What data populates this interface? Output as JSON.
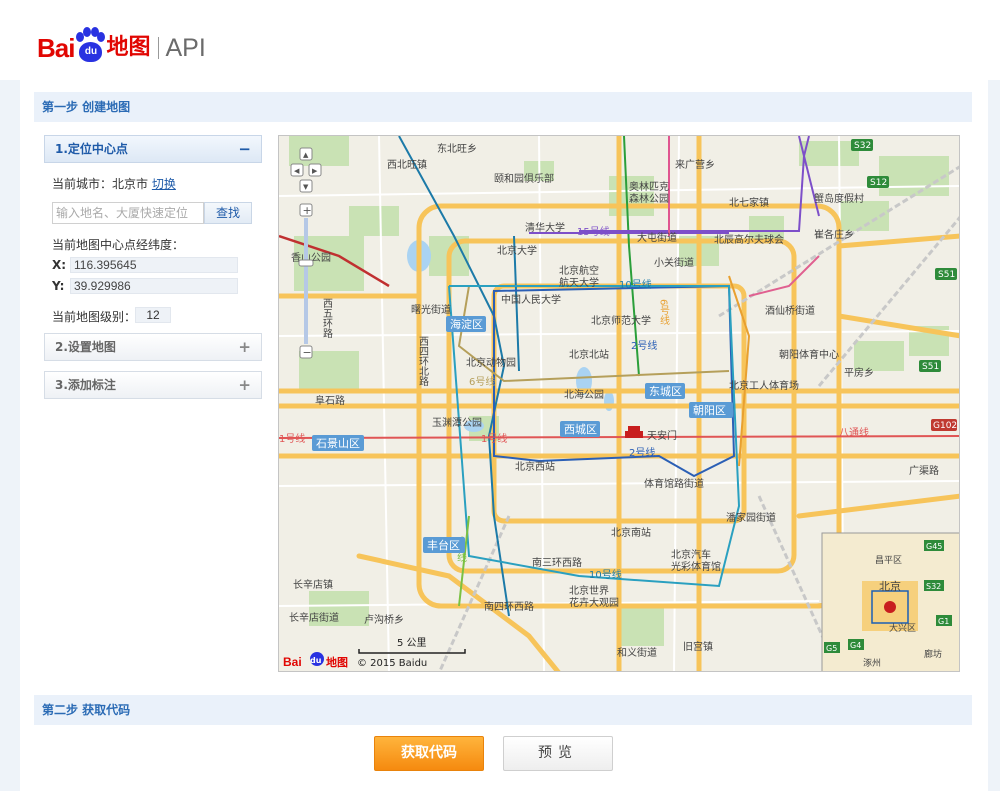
{
  "header": {
    "logo_bai": "Bai",
    "logo_du": "du",
    "logo_map": "地图",
    "logo_api": "API"
  },
  "step1": {
    "title": "第一步 创建地图"
  },
  "sections": [
    {
      "label": "1.定位中心点",
      "sign": "−",
      "expanded": true
    },
    {
      "label": "2.设置地图",
      "sign": "+",
      "expanded": false
    },
    {
      "label": "3.添加标注",
      "sign": "+",
      "expanded": false
    }
  ],
  "locate": {
    "city_label": "当前城市：",
    "city_value": "北京市",
    "switch_link": "切换",
    "search_placeholder": "输入地名、大厦快速定位",
    "search_button": "查找",
    "center_label": "当前地图中心点经纬度：",
    "x_label": "X:",
    "x_value": "116.395645",
    "y_label": "Y:",
    "y_value": "39.929986",
    "zoom_label": "当前地图级别：",
    "zoom_value": "12"
  },
  "map": {
    "scale_label": "5 公里",
    "copyright": "© 2015 Baidu",
    "logo_text": "Bai",
    "logo_du": "du",
    "logo_map": "地图",
    "nav_up": "▲",
    "nav_left": "◀",
    "nav_right": "▶",
    "nav_down": "▼",
    "zoom_in": "+",
    "zoom_out": "−",
    "labels": {
      "dongbeiwang": "东北旺乡",
      "xibeiwang": "西北旺镇",
      "yuanmingyuan": "颐和园俱乐部",
      "aolin": "奥林匹克",
      "senlin": "森林公园",
      "laiguangying": "来广营乡",
      "beiqijia": "北七家镇",
      "s32_top": "S32",
      "s12": "S12",
      "xiezhou": "蟹岛度假村",
      "tsinghua": "清华大学",
      "pku": "北京大学",
      "line15": "15号线",
      "datun": "大屯街道",
      "beichen": "北辰高尔夫球会",
      "cuigezhuang": "崔各庄乡",
      "xiangshan": "香山公园",
      "beihang1": "北京航空",
      "beihang2": "航天大学",
      "xiaoguan": "小关街道",
      "s51_top": "S51",
      "renda": "中国人民大学",
      "line10_top": "10号线",
      "xiwuhuan": "西五环路",
      "shuguang": "曙光街道",
      "beishida": "北京师范大学",
      "jiuxianqiao": "酒仙桥街道",
      "haidian": "海淀区",
      "xisihuan": "西四环北路",
      "bjzoo": "北京动物园",
      "bjnorth": "北京北站",
      "line2_top": "2号线",
      "chaoyangpark": "朝阳体育中心",
      "pingfang": "平房乡",
      "line6": "6号线",
      "s51_mid": "S51",
      "beihai": "北海公园",
      "dongcheng": "东城区",
      "bjworkers": "北京工人体育场",
      "fushilu": "阜石路",
      "chaoyang": "朝阳区",
      "yuyuantan": "玉渊潭公园",
      "g102": "G102",
      "line1_left": "1号线",
      "shijingshan": "石景山区",
      "line1": "1号线",
      "xicheng": "西城区",
      "tiananmen": "天安门",
      "batong": "八通线",
      "line2_bot": "2号线",
      "bjwest": "北京西站",
      "line6_right": "6号线",
      "guangqu": "广渠路",
      "tiyuguan": "体育馆路街道",
      "panjiayuan": "潘家园街道",
      "fengtai": "丰台区",
      "bjsouth": "北京南站",
      "qiche1": "北京汽车",
      "qiche2": "光彩体育馆",
      "nansanhuan": "南三环西路",
      "line9": "9号线",
      "changxindian": "长辛店镇",
      "line10_bot": "10号线",
      "shijie1": "北京世界",
      "shijie2": "花卉大观园",
      "nansihuan": "南四环西路",
      "changxindianjd": "长辛店街道",
      "lugouqiao": "卢沟桥乡",
      "heyi": "和义街道",
      "jiugong": "旧宫镇",
      "g45": "G45",
      "changping": "昌平区",
      "beijing": "北京",
      "daxing": "大兴区",
      "langfang": "廊坊",
      "g1": "G1",
      "s32_inset": "S32",
      "g5": "G5",
      "g4": "G4",
      "zhuozhou": "涿州"
    }
  },
  "step2": {
    "title": "第二步 获取代码"
  },
  "buttons": {
    "get_code": "获取代码",
    "preview": "预览"
  }
}
